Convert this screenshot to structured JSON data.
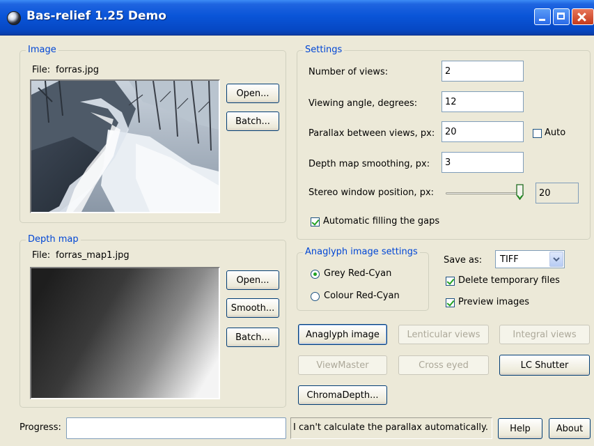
{
  "window": {
    "title": "Bas-relief 1.25 Demo"
  },
  "image_group": {
    "legend": "Image",
    "file_label": "File:",
    "file_name": "forras.jpg",
    "open_label": "Open...",
    "batch_label": "Batch..."
  },
  "depth_group": {
    "legend": "Depth map",
    "file_label": "File:",
    "file_name": "forras_map1.jpg",
    "open_label": "Open...",
    "smooth_label": "Smooth...",
    "batch_label": "Batch..."
  },
  "settings": {
    "legend": "Settings",
    "views_label": "Number of views:",
    "views_value": "2",
    "angle_label": "Viewing angle, degrees:",
    "angle_value": "12",
    "parallax_label": "Parallax between views, px:",
    "parallax_value": "20",
    "auto_label": "Auto",
    "auto_checked": false,
    "smoothing_label": "Depth map smoothing, px:",
    "smoothing_value": "3",
    "stereo_label": "Stereo window position, px:",
    "stereo_value": "20",
    "stereo_slider_fraction": 1.0,
    "fill_gaps_label": "Automatic filling the gaps",
    "fill_gaps_checked": true
  },
  "anaglyph": {
    "legend": "Anaglyph image settings",
    "grey_label": "Grey Red-Cyan",
    "grey_selected": true,
    "colour_label": "Colour Red-Cyan",
    "colour_selected": false
  },
  "output": {
    "save_as_label": "Save as:",
    "save_as_value": "TIFF",
    "delete_temp_label": "Delete temporary files",
    "delete_temp_checked": true,
    "preview_label": "Preview images",
    "preview_checked": true
  },
  "actions": {
    "anaglyph_label": "Anaglyph image",
    "lenticular_label": "Lenticular views",
    "integral_label": "Integral views",
    "viewmaster_label": "ViewMaster",
    "cross_eyed_label": "Cross eyed",
    "lc_shutter_label": "LC Shutter",
    "chromadepth_label": "ChromaDepth..."
  },
  "footer": {
    "progress_label": "Progress:",
    "progress_fraction": 0,
    "status_text": "I can't calculate the parallax automatically.",
    "help_label": "Help",
    "about_label": "About"
  },
  "colors": {
    "titlebar": "#0a55d8",
    "window_bg": "#ece9d8",
    "legend_text": "#0046d5",
    "check_mark": "#21a121"
  }
}
